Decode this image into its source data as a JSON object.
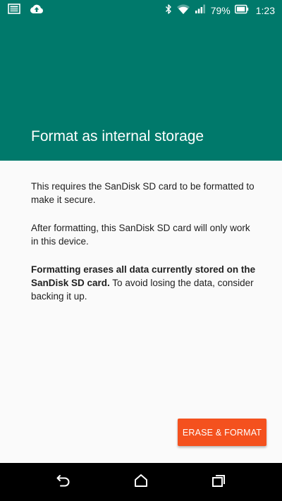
{
  "status_bar": {
    "battery_percent": "79%",
    "time": "1:23",
    "icons": {
      "left": [
        "image-notification-icon",
        "cloud-upload-icon"
      ],
      "right": [
        "bluetooth-icon",
        "wifi-icon",
        "cell-signal-icon",
        "battery-icon"
      ]
    }
  },
  "page": {
    "title": "Format as internal storage",
    "paragraph1": "This requires the SanDisk SD card to be formatted to make it secure.",
    "paragraph2": "After formatting, this SanDisk SD card will only work in this device.",
    "paragraph3_bold": "Formatting erases all data currently stored on the SanDisk SD card.",
    "paragraph3_rest": " To avoid losing the data, consider backing it up."
  },
  "actions": {
    "erase_format_label": "ERASE & FORMAT"
  },
  "nav_bar": {
    "icons": [
      "back-icon",
      "home-icon",
      "recents-icon"
    ]
  },
  "colors": {
    "header": "#00796b",
    "accent_button": "#f4511e",
    "background": "#fafafa",
    "nav_bar": "#000000",
    "text": "#212121"
  }
}
